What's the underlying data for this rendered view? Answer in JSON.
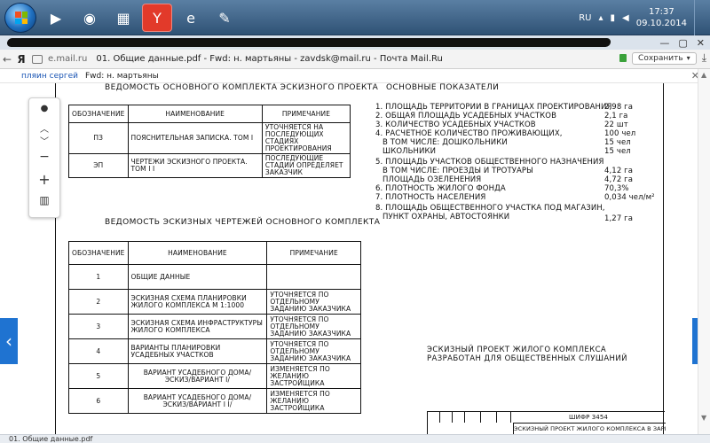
{
  "taskbar": {
    "apps": [
      "start",
      "media-player",
      "browser-app",
      "file-manager",
      "yandex-browser",
      "ie",
      "paint"
    ],
    "tray": {
      "lang": "RU",
      "time": "17:37",
      "date": "09.10.2014"
    }
  },
  "browser": {
    "tab_title": "01. Общие данные.pdf - Fwd: н. мартьяны - zavdsk@mail.ru - Почта Mail.Ru",
    "url": "e.mail.ru",
    "page_title": "01. Общие данные.pdf - Fwd: н. мартьяны - zavdsk@mail.ru - Почта Mail.Ru",
    "save_label": "Сохранить",
    "nav_back": "←",
    "ya": "Я"
  },
  "mail": {
    "sender": "пляин сергей",
    "subject": "Fwd: н. мартьяны"
  },
  "doc": {
    "title_left_top": "ВЕДОМОСТЬ ОСНОВНОГО КОМПЛЕКТА ЭСКИЗНОГО ПРОЕКТА",
    "title_right_top": "ОСНОВНЫЕ ПОКАЗАТЕЛИ",
    "table1": {
      "headers": [
        "ОБОЗНАЧЕНИЕ",
        "НАИМЕНОВАНИЕ",
        "ПРИМЕЧАНИЕ"
      ],
      "rows": [
        [
          "ПЗ",
          "ПОЯСНИТЕЛЬНАЯ ЗАПИСКА. ТОМ I",
          "УТОЧНЯЕТСЯ НА ПОСЛЕДУЮЩИХ СТАДИЯХ ПРОЕКТИРОВАНИЯ"
        ],
        [
          "ЭП",
          "ЧЕРТЕЖИ ЭСКИЗНОГО ПРОЕКТА. ТОМ I I",
          "ПОСЛЕДУЮЩИЕ СТАДИИ ОПРЕДЕЛЯЕТ ЗАКАЗЧИК"
        ]
      ]
    },
    "title_table2": "ВЕДОМОСТЬ ЭСКИЗНЫХ ЧЕРТЕЖЕЙ ОСНОВНОГО КОМПЛЕКТА",
    "table2": {
      "headers": [
        "ОБОЗНАЧЕНИЕ",
        "НАИМЕНОВАНИЕ",
        "ПРИМЕЧАНИЕ"
      ],
      "rows": [
        [
          "1",
          "ОБЩИЕ ДАННЫЕ",
          ""
        ],
        [
          "2",
          "ЭСКИЗНАЯ СХЕМА ПЛАНИРОВКИ ЖИЛОГО КОМПЛЕКСА М 1:1000",
          "УТОЧНЯЕТСЯ ПО ОТДЕЛЬНОМУ ЗАДАНИЮ ЗАКАЗЧИКА"
        ],
        [
          "3",
          "ЭСКИЗНАЯ СХЕМА ИНФРАСТРУКТУРЫ ЖИЛОГО КОМПЛЕКСА",
          "УТОЧНЯЕТСЯ ПО ОТДЕЛЬНОМУ ЗАДАНИЮ ЗАКАЗЧИКА"
        ],
        [
          "4",
          "ВАРИАНТЫ ПЛАНИРОВКИ УСАДЕБНЫХ УЧАСТКОВ",
          "УТОЧНЯЕТСЯ ПО ОТДЕЛЬНОМУ ЗАДАНИЮ ЗАКАЗЧИКА"
        ],
        [
          "5",
          "ВАРИАНТ УСАДЕБНОГО ДОМА/ЭСКИЗ/ВАРИАНТ I/",
          "ИЗМЕНЯЕТСЯ ПО ЖЕЛАНИЮ ЗАСТРОЙЩИКА"
        ],
        [
          "6",
          "ВАРИАНТ УСАДЕБНОГО ДОМА/ЭСКИЗ/ВАРИАНТ I I/",
          "ИЗМЕНЯЕТСЯ ПО ЖЕЛАНИЮ ЗАСТРОЙЩИКА"
        ]
      ]
    },
    "indicators": [
      {
        "label": "1. ПЛОЩАДЬ ТЕРРИТОРИИ В ГРАНИЦАХ ПРОЕКТИРОВАНИЯ",
        "value": "2,98 га"
      },
      {
        "label": "2. ОБЩАЯ ПЛОЩАДЬ УСАДЕБНЫХ УЧАСТКОВ",
        "value": "2,1 га"
      },
      {
        "label": "3. КОЛИЧЕСТВО УСАДЕБНЫХ УЧАСТКОВ",
        "value": "22 шт"
      },
      {
        "label": "4. РАСЧЕТНОЕ КОЛИЧЕСТВО ПРОЖИВАЮЩИХ,",
        "value": "100 чел"
      },
      {
        "label": "   В ТОМ ЧИСЛЕ: ДОШКОЛЬНИКИ",
        "value": "15 чел"
      },
      {
        "label": "   ШКОЛЬНИКИ",
        "value": "15 чел"
      },
      {
        "label": "5. ПЛОЩАДЬ УЧАСТКОВ ОБЩЕСТВЕННОГО НАЗНАЧЕНИЯ",
        "value": ""
      },
      {
        "label": "   В ТОМ ЧИСЛЕ: ПРОЕЗДЫ И ТРОТУАРЫ",
        "value": "4,12 га"
      },
      {
        "label": "   ПЛОЩАДЬ ОЗЕЛЕНЕНИЯ",
        "value": "4,72 га"
      },
      {
        "label": "6. ПЛОТНОСТЬ ЖИЛОГО ФОНДА",
        "value": "70,3%"
      },
      {
        "label": "7. ПЛОТНОСТЬ НАСЕЛЕНИЯ",
        "value": "0,034 чел/м²"
      },
      {
        "label": "8. ПЛОЩАДЬ ОБЩЕСТВЕННОГО УЧАСТКА ПОД МАГАЗИН,",
        "value": ""
      },
      {
        "label": "   ПУНКТ ОХРАНЫ, АВТОСТОЯНКИ",
        "value": "1,27 га"
      }
    ],
    "note": [
      "ЭСКИЗНЫЙ ПРОЕКТ ЖИЛОГО КОМПЛЕКСА",
      "РАЗРАБОТАН ДЛЯ ОБЩЕСТВЕННЫХ СЛУШАНИЙ"
    ],
    "stamp": {
      "code": "ШИФР 3454",
      "name": "ЭСКИЗНЫЙ ПРОЕКТ ЖИЛОГО КОМПЛЕКСА В ЗАРЬЯВОРСКОМ"
    }
  },
  "bottombar": {
    "text": "01. Общие данные.pdf"
  }
}
